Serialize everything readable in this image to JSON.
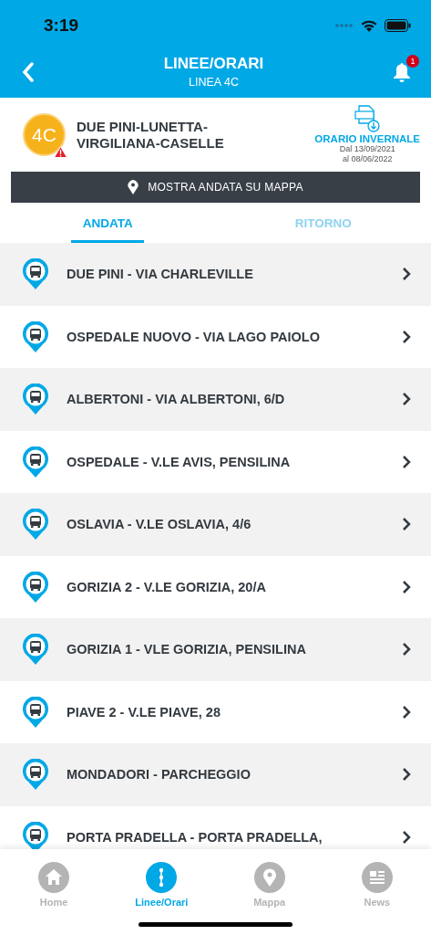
{
  "status_bar": {
    "time": "3:19"
  },
  "header": {
    "title": "LINEE/ORARI",
    "subtitle": "LINEA 4C",
    "notification_count": "1"
  },
  "line": {
    "badge": "4C",
    "alert": true,
    "name": "DUE PINI-LUNETTA-VIRGILIANA-CASELLE",
    "timetable": {
      "label": "ORARIO INVERNALE",
      "from": "Dal 13/09/2021",
      "to": "al 08/06/2022"
    }
  },
  "map_button": "MOSTRA ANDATA SU MAPPA",
  "tabs": [
    {
      "label": "ANDATA",
      "selected": true
    },
    {
      "label": "RITORNO",
      "selected": false
    }
  ],
  "stops": [
    {
      "name": "DUE PINI - VIA CHARLEVILLE"
    },
    {
      "name": "OSPEDALE NUOVO - VIA LAGO PAIOLO"
    },
    {
      "name": "ALBERTONI - VIA ALBERTONI, 6/D"
    },
    {
      "name": "OSPEDALE - V.LE AVIS, PENSILINA"
    },
    {
      "name": "OSLAVIA - V.LE OSLAVIA, 4/6"
    },
    {
      "name": "GORIZIA 2 - V.LE GORIZIA, 20/A"
    },
    {
      "name": "GORIZIA 1 - VLE GORIZIA, PENSILINA"
    },
    {
      "name": "PIAVE 2 - V.LE PIAVE, 28"
    },
    {
      "name": "MONDADORI - PARCHEGGIO"
    },
    {
      "name": "PORTA PRADELLA - PORTA PRADELLA,"
    }
  ],
  "tab_bar": [
    {
      "label": "Home",
      "kind": "home",
      "selected": false
    },
    {
      "label": "Linee/Orari",
      "kind": "lines",
      "selected": true
    },
    {
      "label": "Mappa",
      "kind": "map",
      "selected": false
    },
    {
      "label": "News",
      "kind": "news",
      "selected": false
    }
  ]
}
